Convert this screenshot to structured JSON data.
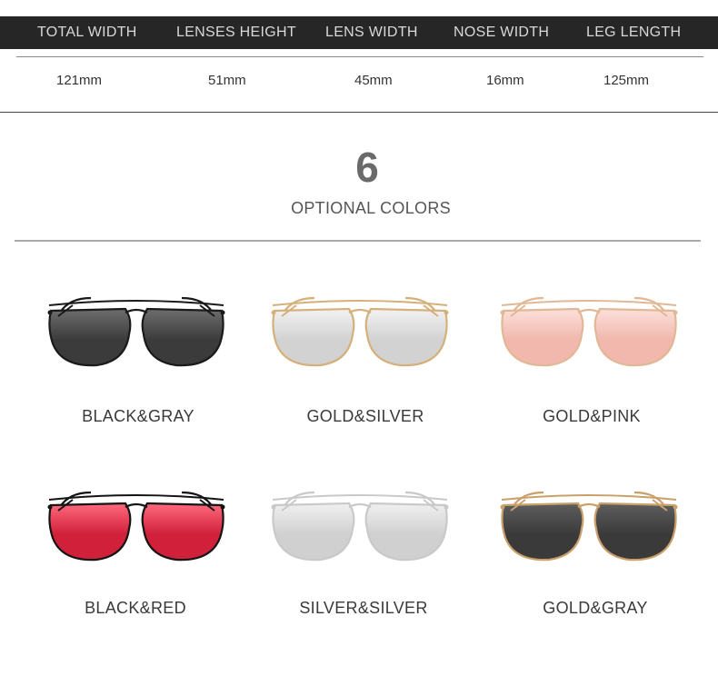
{
  "specs": {
    "headers": [
      "TOTAL WIDTH",
      "LENSES HEIGHT",
      "LENS WIDTH",
      "NOSE WIDTH",
      "LEG LENGTH"
    ],
    "values": [
      "121mm",
      "51mm",
      "45mm",
      "16mm",
      "125mm"
    ]
  },
  "colors_section": {
    "count": "6",
    "subtitle": "OPTIONAL COLORS"
  },
  "products": [
    {
      "label": "BLACK&GRAY",
      "frame": "#1a1a1a",
      "lens": "#3b3b3b",
      "lens_edge": "#6e6e6e"
    },
    {
      "label": "GOLD&SILVER",
      "frame": "#d6b07a",
      "lens": "#d2d2d2",
      "lens_edge": "#f2f2f2"
    },
    {
      "label": "GOLD&PINK",
      "frame": "#e0b896",
      "lens": "#f2b7ad",
      "lens_edge": "#fbe0da"
    },
    {
      "label": "BLACK&RED",
      "frame": "#141414",
      "lens": "#d0203a",
      "lens_edge": "#ff6a7e"
    },
    {
      "label": "SILVER&SILVER",
      "frame": "#c9c9c9",
      "lens": "#d0d0d0",
      "lens_edge": "#f0f0f0"
    },
    {
      "label": "GOLD&GRAY",
      "frame": "#caa06a",
      "lens": "#3a3a3a",
      "lens_edge": "#5e5e5e"
    }
  ]
}
